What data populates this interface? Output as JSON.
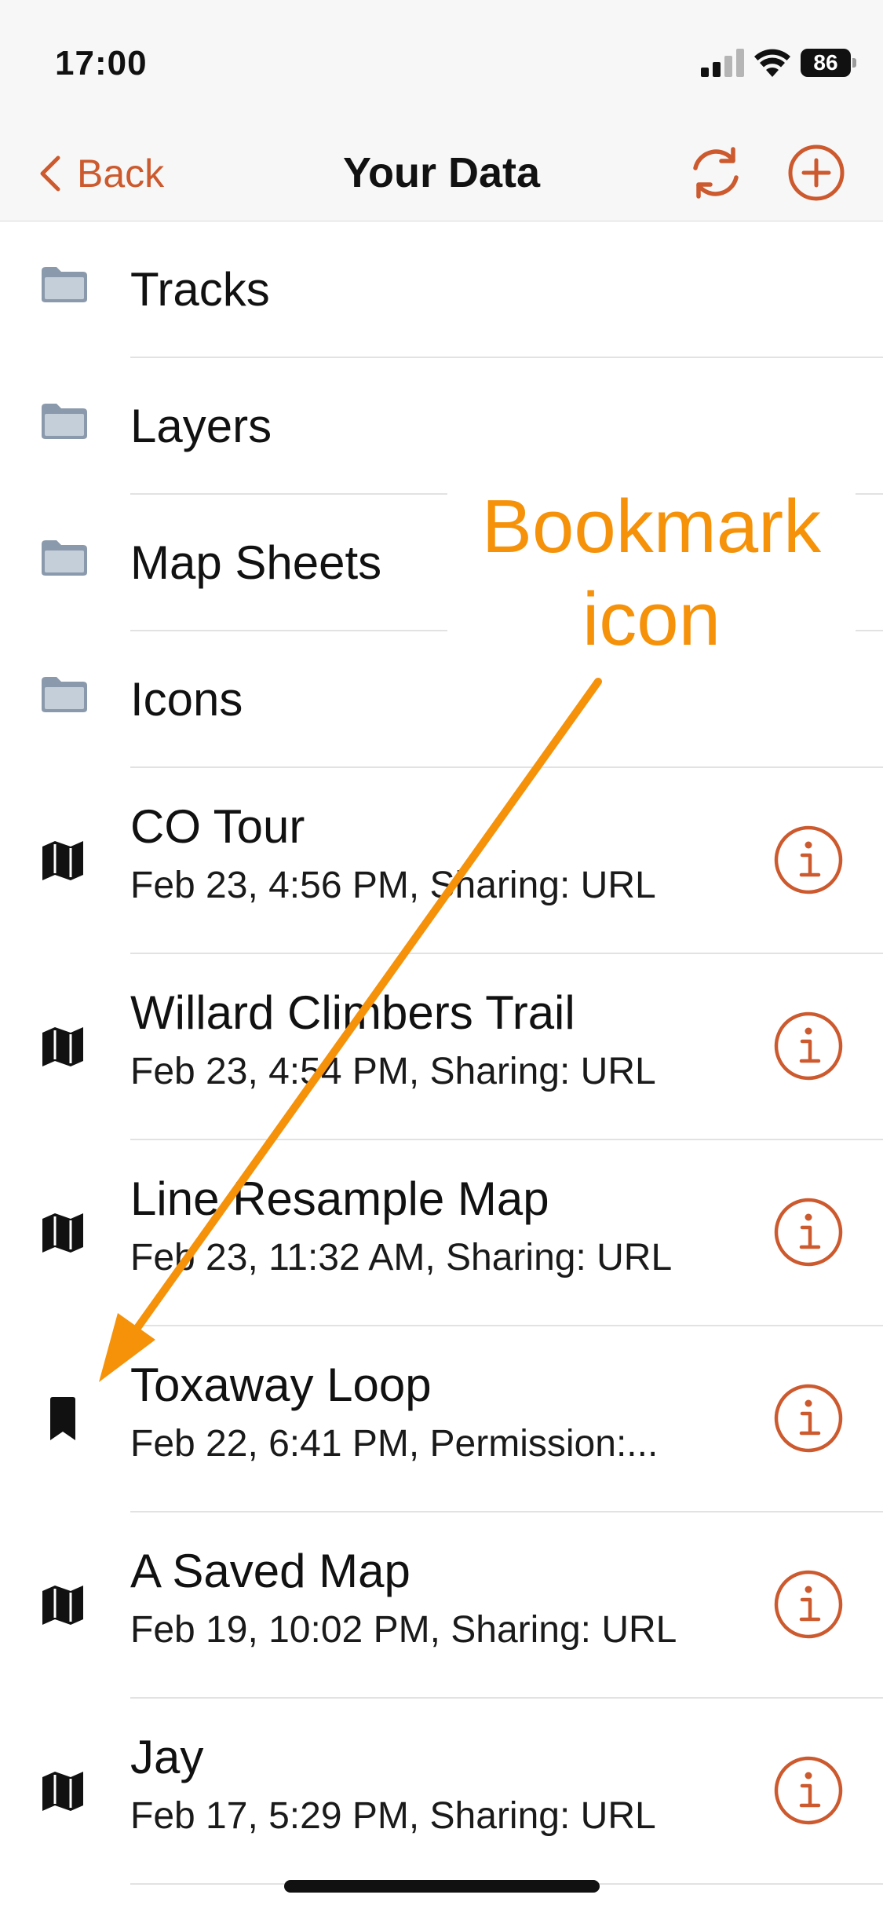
{
  "status_bar": {
    "time": "17:00",
    "battery": "86"
  },
  "nav": {
    "back_label": "Back",
    "title": "Your Data",
    "icons": {
      "back": "chevron-left-icon",
      "sync": "sync-icon",
      "add": "plus-circle-icon"
    }
  },
  "colors": {
    "accent": "#cc5a2e",
    "folder": "#8a99ab",
    "annotation": "#f5920a"
  },
  "folders": [
    {
      "label": "Tracks",
      "icon": "folder-icon"
    },
    {
      "label": "Layers",
      "icon": "folder-icon"
    },
    {
      "label": "Map Sheets",
      "icon": "folder-icon"
    },
    {
      "label": "Icons",
      "icon": "folder-icon"
    }
  ],
  "items": [
    {
      "title": "CO Tour",
      "subtitle": "Feb 23, 4:56 PM, Sharing: URL",
      "icon": "map-icon"
    },
    {
      "title": "Willard Climbers Trail",
      "subtitle": "Feb 23, 4:54 PM, Sharing: URL",
      "icon": "map-icon"
    },
    {
      "title": "Line Resample Map",
      "subtitle": "Feb 23, 11:32 AM, Sharing: URL",
      "icon": "map-icon"
    },
    {
      "title": "Toxaway Loop",
      "subtitle": "Feb 22, 6:41 PM, Permission:...",
      "icon": "bookmark-icon"
    },
    {
      "title": "A Saved Map",
      "subtitle": "Feb 19, 10:02 PM, Sharing: URL",
      "icon": "map-icon"
    },
    {
      "title": "Jay",
      "subtitle": "Feb 17, 5:29 PM, Sharing: URL",
      "icon": "map-icon"
    }
  ],
  "annotation": {
    "line1": "Bookmark",
    "line2": "icon"
  }
}
